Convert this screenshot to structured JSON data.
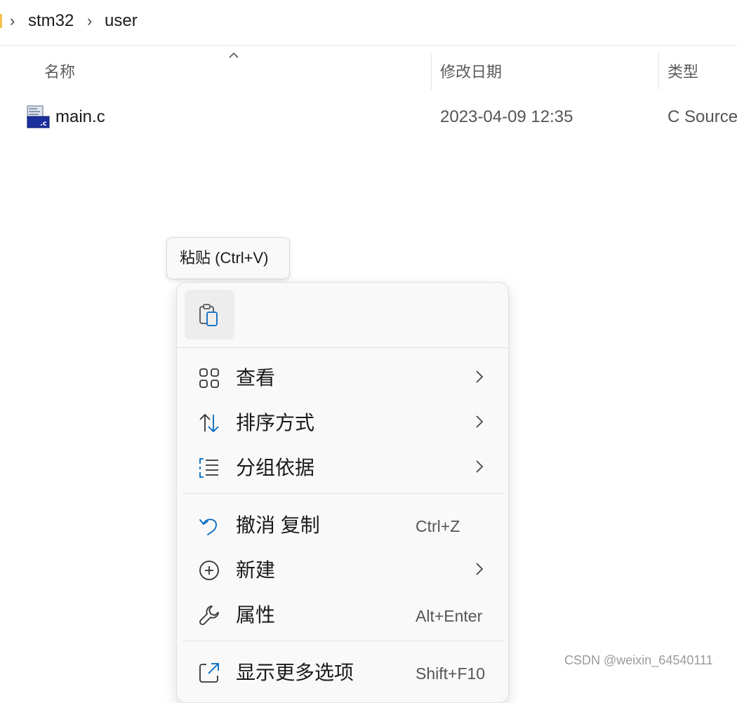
{
  "breadcrumb": {
    "items": [
      "stm32",
      "user"
    ]
  },
  "columns": {
    "name": "名称",
    "date_modified": "修改日期",
    "type": "类型"
  },
  "files": [
    {
      "name": "main.c",
      "date_modified": "2023-04-09 12:35",
      "type": "C Source"
    }
  ],
  "tooltip": {
    "text": "粘贴 (Ctrl+V)"
  },
  "context_menu": {
    "items": [
      {
        "label": "查看",
        "icon": "view-grid-icon",
        "has_submenu": true
      },
      {
        "label": "排序方式",
        "icon": "sort-arrows-icon",
        "has_submenu": true
      },
      {
        "label": "分组依据",
        "icon": "group-list-icon",
        "has_submenu": true
      },
      {
        "label": "撤消 复制",
        "icon": "undo-icon",
        "shortcut": "Ctrl+Z"
      },
      {
        "label": "新建",
        "icon": "new-plus-icon",
        "has_submenu": true
      },
      {
        "label": "属性",
        "icon": "wrench-icon",
        "shortcut": "Alt+Enter"
      },
      {
        "label": "显示更多选项",
        "icon": "more-options-icon",
        "shortcut": "Shift+F10"
      }
    ]
  },
  "watermark": "CSDN @weixin_64540111",
  "colors": {
    "accent": "#0067c0",
    "folder": "#f2c14e"
  }
}
